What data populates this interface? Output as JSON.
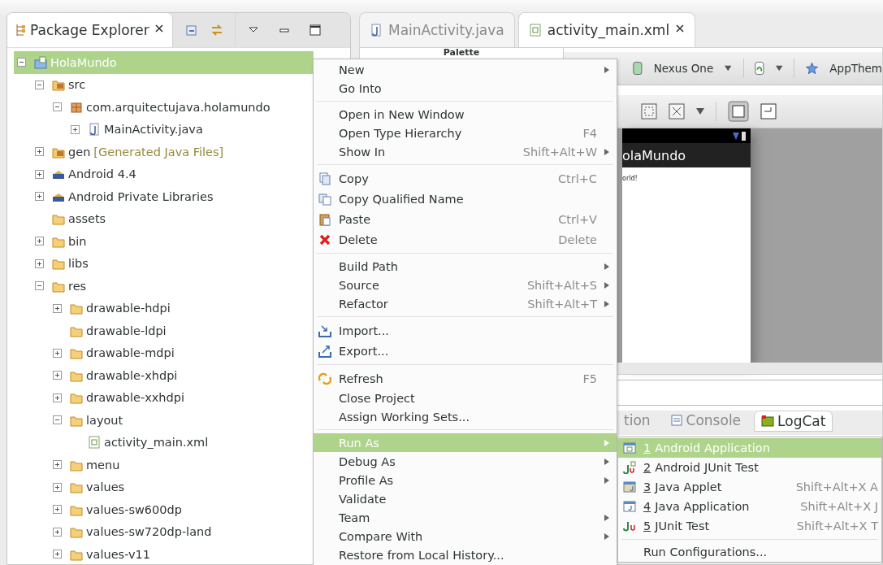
{
  "explorer": {
    "title": "Package Explorer",
    "tree": [
      {
        "label": "HolaMundo",
        "kind": "project",
        "expanded": true,
        "selected": true,
        "children": [
          {
            "label": "src",
            "kind": "srcfolder",
            "expanded": true,
            "selected": false,
            "children": [
              {
                "label": "com.arquitectujava.holamundo",
                "kind": "package",
                "expanded": true,
                "selected": false,
                "children": [
                  {
                    "label": "MainActivity.java",
                    "kind": "java",
                    "expanded": false,
                    "selected": false
                  }
                ]
              }
            ]
          },
          {
            "label": "gen",
            "decoration": "[Generated Java Files]",
            "kind": "srcfolder",
            "expanded": false,
            "selected": false
          },
          {
            "label": "Android 4.4",
            "kind": "library",
            "expanded": false,
            "selected": false
          },
          {
            "label": "Android Private Libraries",
            "kind": "library",
            "expanded": false,
            "selected": false
          },
          {
            "label": "assets",
            "kind": "folder",
            "selected": false
          },
          {
            "label": "bin",
            "kind": "folder",
            "expanded": false,
            "selected": false
          },
          {
            "label": "libs",
            "kind": "folder",
            "expanded": false,
            "selected": false
          },
          {
            "label": "res",
            "kind": "folder",
            "expanded": true,
            "selected": false,
            "children": [
              {
                "label": "drawable-hdpi",
                "kind": "folder",
                "expanded": false,
                "selected": false
              },
              {
                "label": "drawable-ldpi",
                "kind": "folder",
                "selected": false
              },
              {
                "label": "drawable-mdpi",
                "kind": "folder",
                "expanded": false,
                "selected": false
              },
              {
                "label": "drawable-xhdpi",
                "kind": "folder",
                "expanded": false,
                "selected": false
              },
              {
                "label": "drawable-xxhdpi",
                "kind": "folder",
                "expanded": false,
                "selected": false
              },
              {
                "label": "layout",
                "kind": "folder",
                "expanded": true,
                "selected": false,
                "children": [
                  {
                    "label": "activity_main.xml",
                    "kind": "xml",
                    "selected": false
                  }
                ]
              },
              {
                "label": "menu",
                "kind": "folder",
                "expanded": false,
                "selected": false
              },
              {
                "label": "values",
                "kind": "folder",
                "expanded": false,
                "selected": false
              },
              {
                "label": "values-sw600dp",
                "kind": "folder",
                "expanded": false,
                "selected": false
              },
              {
                "label": "values-sw720dp-land",
                "kind": "folder",
                "expanded": false,
                "selected": false
              },
              {
                "label": "values-v11",
                "kind": "folder",
                "expanded": false,
                "selected": false
              }
            ]
          }
        ]
      }
    ]
  },
  "editor": {
    "tabs": [
      {
        "label": "MainActivity.java",
        "kind": "java",
        "selected": false
      },
      {
        "label": "activity_main.xml",
        "kind": "xml",
        "selected": true
      }
    ],
    "palette": {
      "title": "Palette"
    },
    "toolbar": {
      "device": "Nexus One",
      "theme": "AppThem"
    },
    "preview": {
      "app_title": "olaMundo",
      "body_text": "orld!"
    },
    "bottom_tabs": [
      {
        "label": "tion",
        "kind": "plain",
        "selected": false
      },
      {
        "label": "Console",
        "kind": "console",
        "selected": false
      },
      {
        "label": "LogCat",
        "kind": "logcat",
        "selected": true
      }
    ]
  },
  "context_menu": {
    "groups": [
      [
        {
          "label": "New",
          "submenu": true,
          "selected": false
        },
        {
          "label": "Go Into",
          "selected": false
        }
      ],
      [
        {
          "label": "Open in New Window",
          "selected": false
        },
        {
          "label": "Open Type Hierarchy",
          "shortcut": "F4",
          "selected": false
        },
        {
          "label": "Show In",
          "shortcut": "Shift+Alt+W",
          "submenu": true,
          "selected": false
        }
      ],
      [
        {
          "label": "Copy",
          "kind": "copy",
          "shortcut": "Ctrl+C",
          "selected": false
        },
        {
          "label": "Copy Qualified Name",
          "kind": "copyname",
          "selected": false
        },
        {
          "label": "Paste",
          "kind": "paste",
          "shortcut": "Ctrl+V",
          "selected": false
        },
        {
          "label": "Delete",
          "kind": "delete",
          "shortcut": "Delete",
          "selected": false
        }
      ],
      [
        {
          "label": "Build Path",
          "submenu": true,
          "selected": false
        },
        {
          "label": "Source",
          "shortcut": "Shift+Alt+S",
          "submenu": true,
          "selected": false
        },
        {
          "label": "Refactor",
          "shortcut": "Shift+Alt+T",
          "submenu": true,
          "selected": false
        }
      ],
      [
        {
          "label": "Import...",
          "kind": "import",
          "selected": false
        },
        {
          "label": "Export...",
          "kind": "export",
          "selected": false
        }
      ],
      [
        {
          "label": "Refresh",
          "kind": "refresh",
          "shortcut": "F5",
          "selected": false
        },
        {
          "label": "Close Project",
          "selected": false
        },
        {
          "label": "Assign Working Sets...",
          "selected": false
        }
      ],
      [
        {
          "label": "Run As",
          "submenu": true,
          "selected": true
        },
        {
          "label": "Debug As",
          "submenu": true,
          "selected": false
        },
        {
          "label": "Profile As",
          "submenu": true,
          "selected": false
        },
        {
          "label": "Validate",
          "selected": false
        },
        {
          "label": "Team",
          "submenu": true,
          "selected": false
        },
        {
          "label": "Compare With",
          "submenu": true,
          "selected": false
        },
        {
          "label": "Restore from Local History...",
          "selected": false
        }
      ]
    ]
  },
  "run_as_menu": {
    "groups": [
      [
        {
          "key": "1",
          "label": "Android Application",
          "kind": "androidapp",
          "selected": true
        },
        {
          "key": "2",
          "label": "Android JUnit Test",
          "kind": "androidjunit",
          "selected": false
        },
        {
          "key": "3",
          "label": "Java Applet",
          "kind": "applet",
          "shortcut": "Shift+Alt+X A",
          "selected": false
        },
        {
          "key": "4",
          "label": "Java Application",
          "kind": "javaapp",
          "shortcut": "Shift+Alt+X J",
          "selected": false
        },
        {
          "key": "5",
          "label": "JUnit Test",
          "kind": "junit",
          "shortcut": "Shift+Alt+X T",
          "selected": false
        }
      ],
      [
        {
          "label": "Run Configurations...",
          "selected": false
        }
      ]
    ]
  }
}
